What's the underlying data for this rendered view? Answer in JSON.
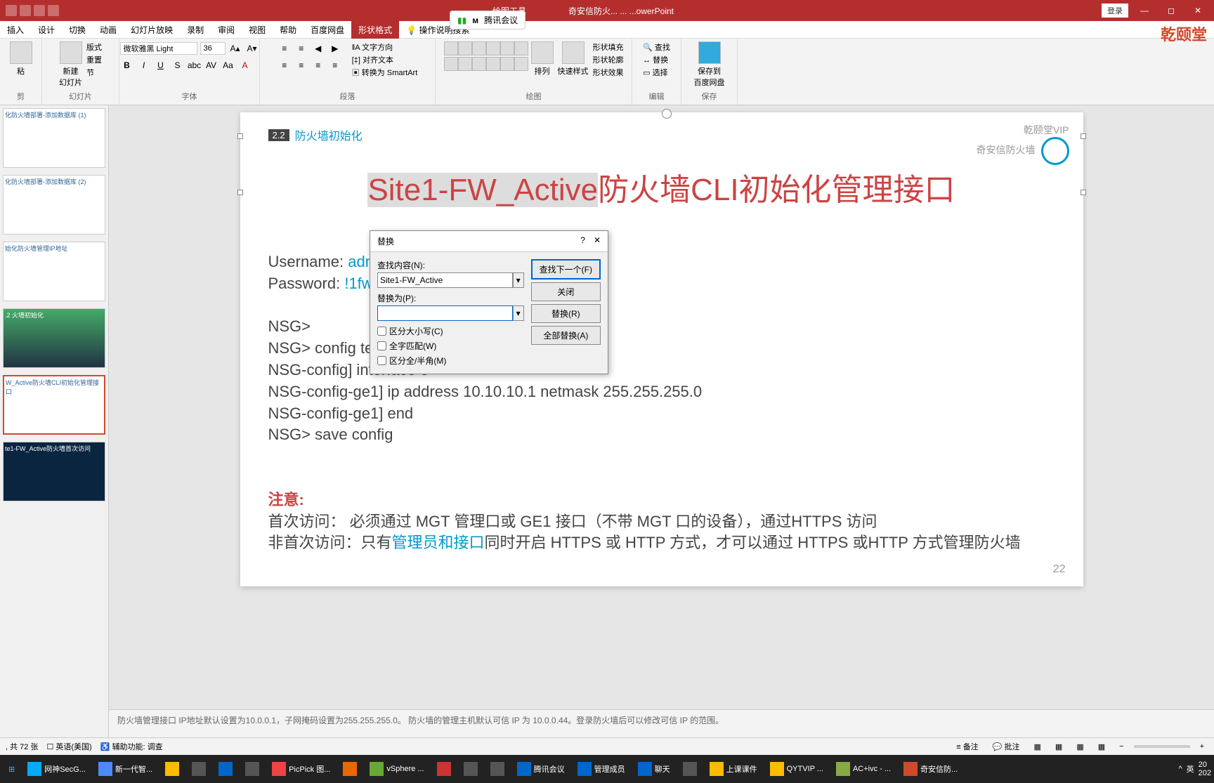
{
  "titlebar": {
    "tool_context": "绘图工具",
    "doc_title": "奇安信防火... ... ...owerPoint",
    "meeting": "腾讯会议",
    "login": "登录"
  },
  "tabs": [
    "插入",
    "设计",
    "切换",
    "动画",
    "幻灯片放映",
    "录制",
    "审阅",
    "视图",
    "帮助",
    "百度网盘",
    "形状格式",
    "操作说明搜索"
  ],
  "ribbon": {
    "clipboard": {
      "label": "幻灯片",
      "new_slide": "新建\n幻灯片",
      "layout": "版式",
      "reset": "重置",
      "section": "节"
    },
    "font": {
      "label": "字体",
      "name": "微软雅黑 Light",
      "size": "36"
    },
    "para": {
      "label": "段落",
      "text_dir": "文字方向",
      "align": "对齐文本",
      "smartart": "转换为 SmartArt"
    },
    "draw": {
      "label": "绘图",
      "arrange": "排列",
      "quick": "快速样式",
      "fill": "形状填充",
      "outline": "形状轮廓",
      "effect": "形状效果"
    },
    "edit": {
      "label": "编辑",
      "find": "查找",
      "replace": "替换",
      "select": "选择"
    },
    "save": {
      "label": "保存",
      "save_cloud": "保存到\n百度网盘"
    }
  },
  "thumbs": [
    {
      "label": "化防火墙部署-添加数据库 (1)"
    },
    {
      "label": "化防火墙部署-添加数据库 (2)"
    },
    {
      "label": "始化防火墙管理IP地址"
    },
    {
      "label": ".2\n火墙初始化"
    },
    {
      "label": "W_Active防火墙CLI初始化管理接口"
    },
    {
      "label": "te1-FW_Active防火墙首次访问"
    }
  ],
  "slide": {
    "badge": "2.2",
    "section": "防火墙初始化",
    "vip1": "乾颐堂VIP",
    "vip2": "奇安信防火墙",
    "vip3": "乾颐堂",
    "title_hl": "Site1-FW_Active",
    "title_rest": "防火墙CLI初始化管理接口",
    "username_lbl": "Username: ",
    "username": "admin",
    "password_lbl": "Password: ",
    "password": "!1fw@2soc#",
    "cli1": "NSG>",
    "cli2": "NSG> config terminal",
    "cli3": "NSG-config] interface e",
    "cli4": "NSG-config-ge1] ip address 10.10.10.1 netmask 255.255.255.0",
    "cli5": "NSG-config-ge1] end",
    "cli6": "NSG> save config",
    "warn": "注意:",
    "note1a": "首次访问：    必须通过 MGT 管理口或 GE1 接口（不带 MGT 口的设备），通过HTTPS 访问",
    "note2a": "非首次访问：只有",
    "note2b": "管理员和接口",
    "note2c": "同时开启 HTTPS 或 HTTP 方式，才可以通过 HTTPS 或HTTP 方式管理防火墙",
    "page": "22"
  },
  "notes": "防火墙管理接口 IP地址默认设置为10.0.0.1，子网掩码设置为255.255.255.0。 防火墙的管理主机默认可信 IP 为 10.0.0.44。登录防火墙后可以修改可信 IP 的范围。",
  "dialog": {
    "title": "替换",
    "find_lbl": "查找内容(N):",
    "find_val": "Site1-FW_Active",
    "replace_lbl": "替换为(P):",
    "replace_val": "",
    "chk1": "区分大小写(C)",
    "chk2": "全字匹配(W)",
    "chk3": "区分全/半角(M)",
    "btn_find": "查找下一个(F)",
    "btn_close": "关闭",
    "btn_replace": "替换(R)",
    "btn_all": "全部替换(A)"
  },
  "status": {
    "slide_count": ", 共 72 张",
    "lang": "英语(美国)",
    "access": "辅助功能: 调查",
    "notes_btn": "备注",
    "comments": "批注"
  },
  "taskbar": {
    "items": [
      "网神SecG...",
      "新一代智...",
      "",
      "",
      "",
      "",
      "PicPick 图...",
      "",
      "vSphere ...",
      "",
      "",
      "",
      "腾讯会议",
      "管理成员",
      "聊天",
      "",
      "上课课件",
      "QYTVIP ...",
      "AC+ivc - ...",
      "奇安信防..."
    ],
    "tray": [
      "英",
      "20",
      "202"
    ]
  },
  "watermark": "乾颐堂"
}
